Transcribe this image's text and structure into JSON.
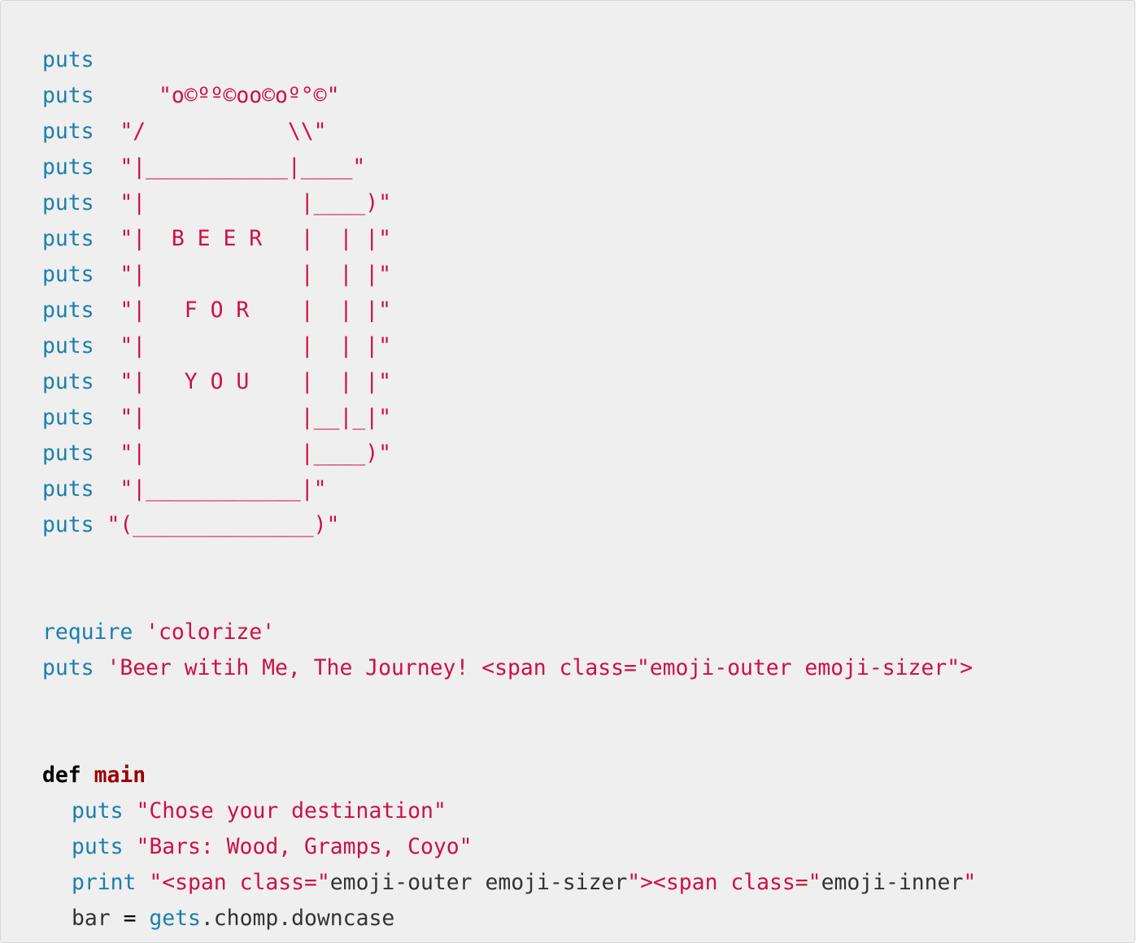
{
  "theme": {
    "background": "#efefef",
    "keyword_color": "#1a7fad",
    "string_color": "#cc1144",
    "def_color": "#000000",
    "function_name_color": "#990000",
    "plain_color": "#333333"
  },
  "code": {
    "art": [
      {
        "kw": "puts",
        "gap": "",
        "str": ""
      },
      {
        "kw": "puts",
        "gap": "     ",
        "str": "\"o©ºº©oo©oº°©\""
      },
      {
        "kw": "puts",
        "gap": "  ",
        "str": "\"/           \\\\\""
      },
      {
        "kw": "puts",
        "gap": "  ",
        "str": "\"|___________|____\""
      },
      {
        "kw": "puts",
        "gap": "  ",
        "str": "\"|            |____)\""
      },
      {
        "kw": "puts",
        "gap": "  ",
        "str": "\"|  B E E R   |  | |\""
      },
      {
        "kw": "puts",
        "gap": "  ",
        "str": "\"|            |  | |\""
      },
      {
        "kw": "puts",
        "gap": "  ",
        "str": "\"|   F O R    |  | |\""
      },
      {
        "kw": "puts",
        "gap": "  ",
        "str": "\"|            |  | |\""
      },
      {
        "kw": "puts",
        "gap": "  ",
        "str": "\"|   Y O U    |  | |\""
      },
      {
        "kw": "puts",
        "gap": "  ",
        "str": "\"|            |__|_|\""
      },
      {
        "kw": "puts",
        "gap": "  ",
        "str": "\"|            |____)\""
      },
      {
        "kw": "puts",
        "gap": "  ",
        "str": "\"|____________|\""
      },
      {
        "kw": "puts",
        "gap": " ",
        "str": "\"(______________)\""
      }
    ],
    "require_line": {
      "kw": "require",
      "str": "'colorize'"
    },
    "journey_line": {
      "kw": "puts",
      "str": "'Beer witih Me, The Journey! <span class=\"emoji-outer emoji-sizer\">"
    },
    "def_line": {
      "kw": "def",
      "name": "main"
    },
    "body": [
      {
        "kw": "puts",
        "str": "\"Chose your destination\""
      },
      {
        "kw": "puts",
        "str": "\"Bars: Wood, Gramps, Coyo\""
      }
    ],
    "print_line": {
      "kw": "print",
      "s1": "\"<span class=\"",
      "p1": "emoji-outer emoji-sizer",
      "s2": "\"><span class=\"",
      "p2": "emoji-inner",
      "s3": "\""
    },
    "gets_line": {
      "var": "bar",
      "op": "=",
      "kw": "gets",
      "rest": ".chomp.downcase"
    }
  }
}
